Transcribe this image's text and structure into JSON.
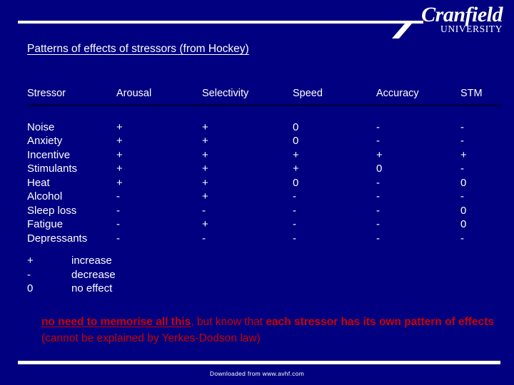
{
  "brand": {
    "name": "Cranfield",
    "subtitle": "UNIVERSITY"
  },
  "slide": {
    "title": "Patterns of effects of stressors (from Hockey)"
  },
  "table": {
    "columns": [
      "Stressor",
      "Arousal",
      "Selectivity",
      "Speed",
      "Accuracy",
      "STM"
    ],
    "rows": [
      [
        "Noise",
        "+",
        "+",
        "0",
        "-",
        "-"
      ],
      [
        "Anxiety",
        "+",
        "+",
        "0",
        "-",
        "-"
      ],
      [
        "Incentive",
        "+",
        "+",
        "+",
        "+",
        "+"
      ],
      [
        "Stimulants",
        "+",
        "+",
        "+",
        "0",
        "-"
      ],
      [
        "Heat",
        "+",
        "+",
        "0",
        "-",
        "0"
      ],
      [
        "Alcohol",
        "-",
        "+",
        "-",
        "-",
        "-"
      ],
      [
        "Sleep loss",
        "-",
        "-",
        "-",
        "-",
        "0"
      ],
      [
        "Fatigue",
        "-",
        "+",
        "-",
        "-",
        "0"
      ],
      [
        "Depressants",
        "-",
        "-",
        "-",
        "-",
        "-"
      ]
    ]
  },
  "legend": [
    {
      "symbol": "+",
      "meaning": "increase"
    },
    {
      "symbol": "-",
      "meaning": "decrease"
    },
    {
      "symbol": "0",
      "meaning": "no effect"
    }
  ],
  "note": {
    "emphasis_underlined": "no need to memorise all this",
    "part_plain_1": ", but know that ",
    "emphasis_bold_1": "each stressor has its own pattern of effects",
    "part_plain_2": " (cannot be explained by Yerkes-Dodson law)"
  },
  "footer": {
    "text": "Downloaded from www.avhf.com"
  },
  "colors": {
    "background": "#000080",
    "text": "#ffffff",
    "note": "#cc0000",
    "rule": "#ffffff",
    "table_rule": "#00004d"
  }
}
